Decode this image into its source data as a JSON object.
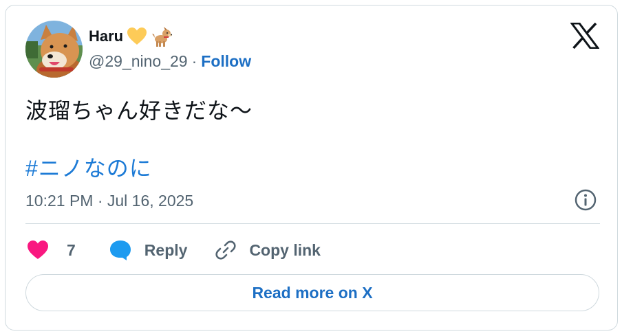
{
  "user": {
    "display_name": "Haru",
    "handle": "@29_nino_29",
    "separator": "·",
    "follow_label": "Follow"
  },
  "tweet": {
    "text": "波瑠ちゃん好きだな〜",
    "hashtag": "#ニノなのに",
    "timestamp": "10:21 PM · Jul 16, 2025"
  },
  "actions": {
    "like_count": "7",
    "reply_label": "Reply",
    "copy_link_label": "Copy link"
  },
  "footer": {
    "read_more_label": "Read more on X"
  },
  "colors": {
    "link_blue": "#1d6fc4",
    "hashtag_blue": "#1d7bd6",
    "heart_pink": "#f91880",
    "reply_blue": "#1d9bf0",
    "secondary_text": "#536471",
    "border": "#cfd9de"
  },
  "icons": [
    "yellow-heart-icon",
    "dog-icon",
    "x-logo-icon",
    "info-icon",
    "heart-icon",
    "reply-bubble-icon",
    "link-icon"
  ]
}
